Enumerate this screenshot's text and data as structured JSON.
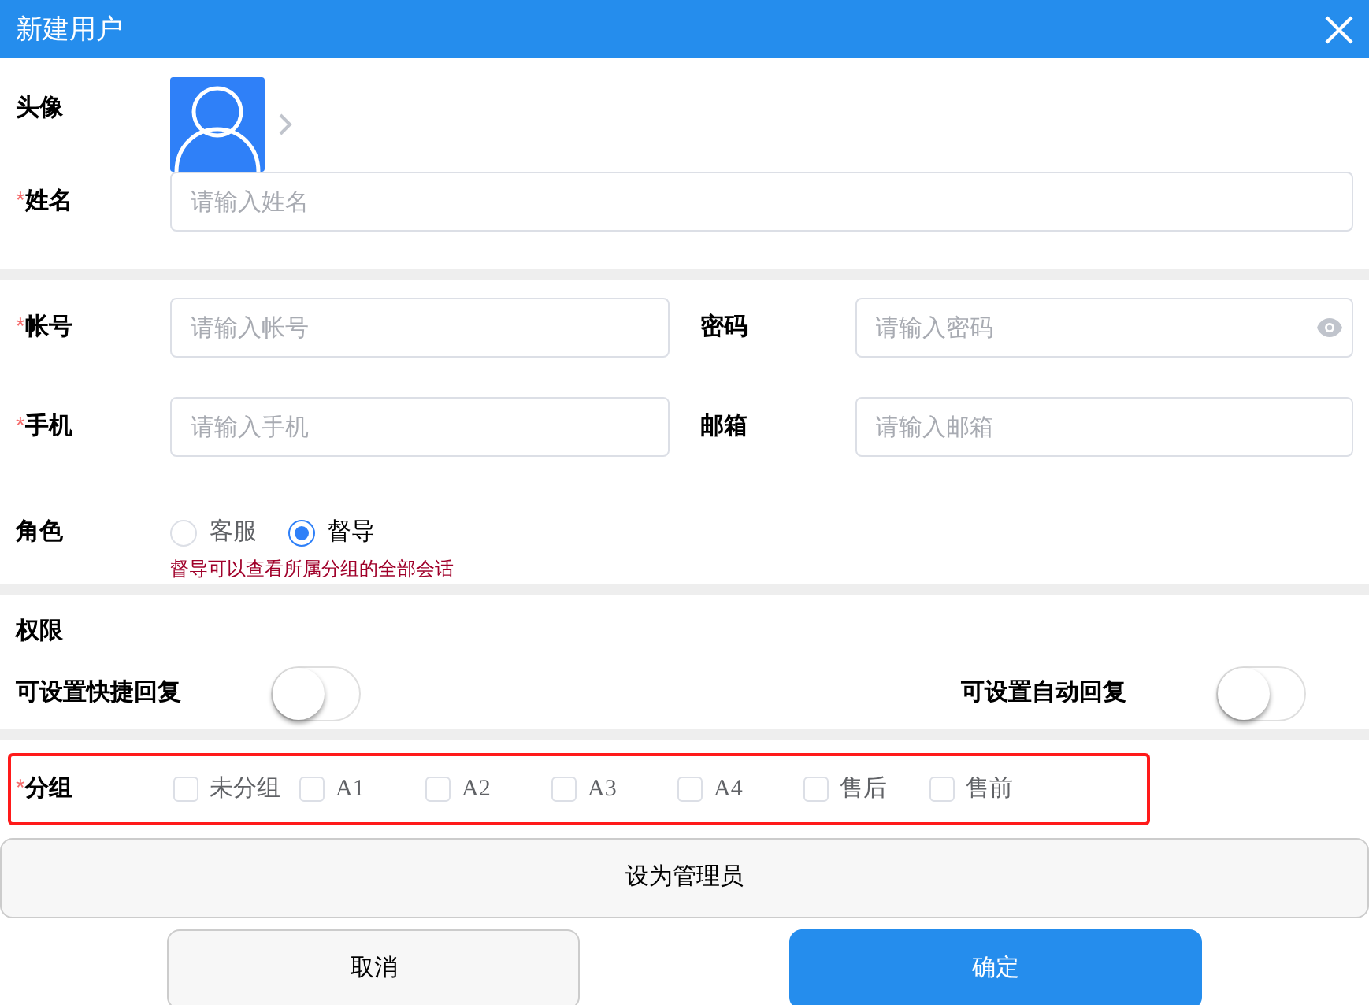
{
  "window": {
    "title": "新建用户"
  },
  "avatar": {
    "label": "头像"
  },
  "name_field": {
    "required": "*",
    "label": "姓名",
    "placeholder": "请输入姓名"
  },
  "field_rows": [
    [
      {
        "required": "*",
        "label": "帐号",
        "placeholder": "请输入帐号",
        "password": false
      },
      {
        "label": "密码",
        "placeholder": "请输入密码",
        "password": true
      }
    ],
    [
      {
        "required": "*",
        "label": "手机",
        "placeholder": "请输入手机",
        "password": false
      },
      {
        "label": "邮箱",
        "placeholder": "请输入邮箱",
        "password": false
      }
    ]
  ],
  "role": {
    "label": "角色",
    "options": [
      {
        "label": "客服",
        "selected": false
      },
      {
        "label": "督导",
        "selected": true
      }
    ],
    "hint": "督导可以查看所属分组的全部会话"
  },
  "permissions": {
    "title": "权限",
    "toggles": [
      {
        "label": "可设置快捷回复",
        "on": false
      },
      {
        "label": "可设置自动回复",
        "on": false
      }
    ]
  },
  "groups": {
    "required": "*",
    "label": "分组",
    "items": [
      {
        "label": "未分组",
        "checked": false
      },
      {
        "label": "A1",
        "checked": false
      },
      {
        "label": "A2",
        "checked": false
      },
      {
        "label": "A3",
        "checked": false
      },
      {
        "label": "A4",
        "checked": false
      },
      {
        "label": "售后",
        "checked": false
      },
      {
        "label": "售前",
        "checked": false
      }
    ]
  },
  "admin_button": "设为管理员",
  "buttons": {
    "cancel": "取消",
    "confirm": "确定"
  }
}
